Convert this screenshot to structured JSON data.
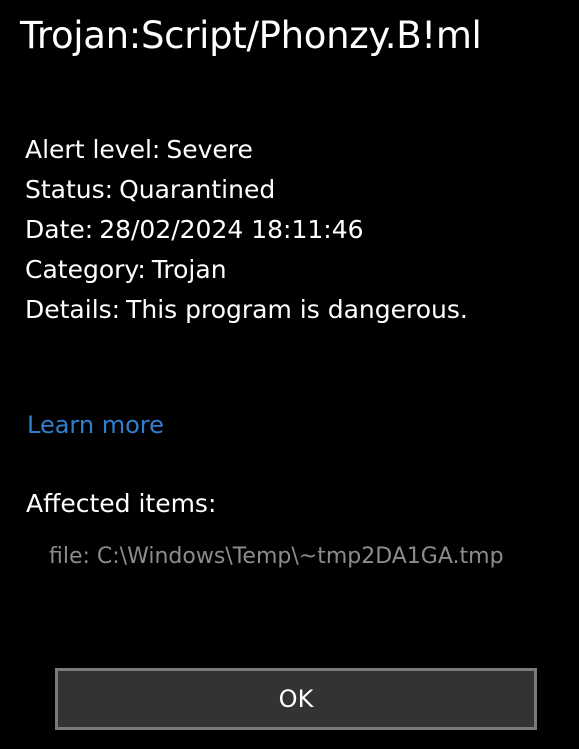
{
  "dialog": {
    "title": "Trojan:Script/Phonzy.B!ml",
    "details": [
      {
        "label": "Alert level:",
        "value": "Severe"
      },
      {
        "label": "Status:",
        "value": "Quarantined"
      },
      {
        "label": "Date:",
        "value": "28/02/2024 18:11:46"
      },
      {
        "label": "Category:",
        "value": "Trojan"
      },
      {
        "label": "Details:",
        "value": "This program is dangerous."
      }
    ],
    "learn_more_label": "Learn more",
    "affected_heading": "Affected items:",
    "affected_items": [
      "file: C:\\Windows\\Temp\\~tmp2DA1GA.tmp"
    ],
    "ok_label": "OK"
  },
  "colors": {
    "background": "#000000",
    "text": "#ffffff",
    "link": "#2f7fd1",
    "muted": "#8c8c8c",
    "button_bg": "#333333",
    "button_border": "#7a7a7a"
  }
}
